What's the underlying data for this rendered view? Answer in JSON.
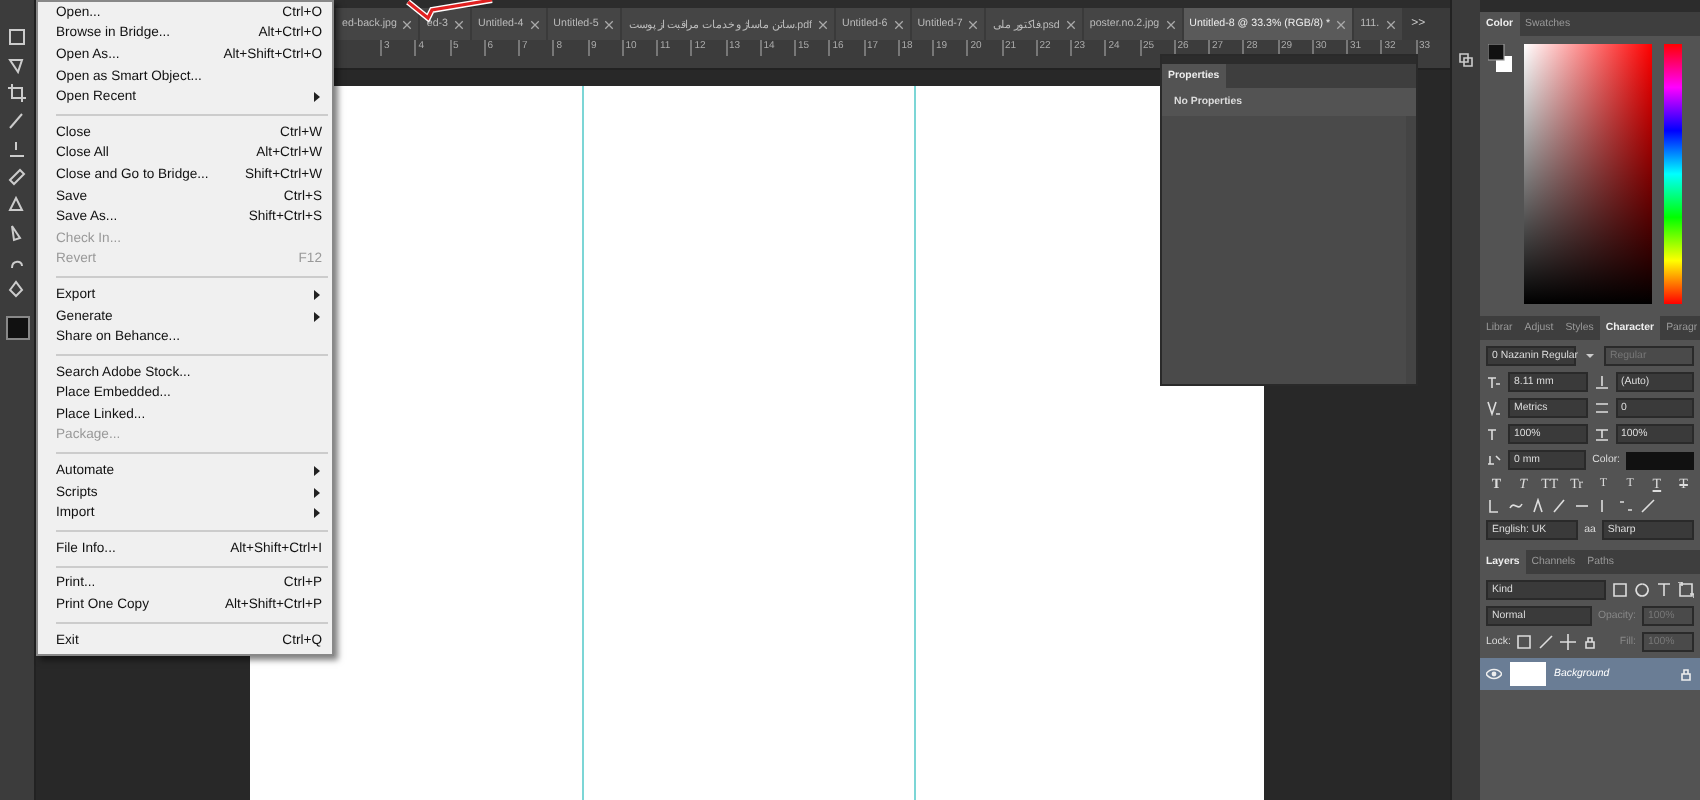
{
  "file_menu": {
    "items": [
      {
        "kind": "item",
        "label": "Open...",
        "shortcut": "Ctrl+O",
        "submenu": false,
        "disabled": false
      },
      {
        "kind": "item",
        "label": "Browse in Bridge...",
        "shortcut": "Alt+Ctrl+O",
        "submenu": false,
        "disabled": false
      },
      {
        "kind": "item",
        "label": "Open As...",
        "shortcut": "Alt+Shift+Ctrl+O",
        "submenu": false,
        "disabled": false
      },
      {
        "kind": "item",
        "label": "Open as Smart Object...",
        "submenu": false,
        "disabled": false
      },
      {
        "kind": "item",
        "label": "Open Recent",
        "submenu": true,
        "disabled": false
      },
      {
        "kind": "separator"
      },
      {
        "kind": "item",
        "label": "Close",
        "shortcut": "Ctrl+W",
        "submenu": false,
        "disabled": false
      },
      {
        "kind": "item",
        "label": "Close All",
        "shortcut": "Alt+Ctrl+W",
        "submenu": false,
        "disabled": false
      },
      {
        "kind": "item",
        "label": "Close and Go to Bridge...",
        "shortcut": "Shift+Ctrl+W",
        "submenu": false,
        "disabled": false
      },
      {
        "kind": "item",
        "label": "Save",
        "shortcut": "Ctrl+S",
        "submenu": false,
        "disabled": false
      },
      {
        "kind": "item",
        "label": "Save As...",
        "shortcut": "Shift+Ctrl+S",
        "submenu": false,
        "disabled": false
      },
      {
        "kind": "item",
        "label": "Check In...",
        "submenu": false,
        "disabled": true
      },
      {
        "kind": "item",
        "label": "Revert",
        "shortcut": "F12",
        "submenu": false,
        "disabled": true
      },
      {
        "kind": "separator"
      },
      {
        "kind": "item",
        "label": "Export",
        "submenu": true,
        "disabled": false
      },
      {
        "kind": "item",
        "label": "Generate",
        "submenu": true,
        "disabled": false
      },
      {
        "kind": "item",
        "label": "Share on Behance...",
        "submenu": false,
        "disabled": false
      },
      {
        "kind": "separator"
      },
      {
        "kind": "item",
        "label": "Search Adobe Stock...",
        "submenu": false,
        "disabled": false
      },
      {
        "kind": "item",
        "label": "Place Embedded...",
        "submenu": false,
        "disabled": false
      },
      {
        "kind": "item",
        "label": "Place Linked...",
        "submenu": false,
        "disabled": false
      },
      {
        "kind": "item",
        "label": "Package...",
        "submenu": false,
        "disabled": true
      },
      {
        "kind": "separator"
      },
      {
        "kind": "item",
        "label": "Automate",
        "submenu": true,
        "disabled": false
      },
      {
        "kind": "item",
        "label": "Scripts",
        "submenu": true,
        "disabled": false
      },
      {
        "kind": "item",
        "label": "Import",
        "submenu": true,
        "disabled": false
      },
      {
        "kind": "separator"
      },
      {
        "kind": "item",
        "label": "File Info...",
        "shortcut": "Alt+Shift+Ctrl+I",
        "submenu": false,
        "disabled": false
      },
      {
        "kind": "separator"
      },
      {
        "kind": "item",
        "label": "Print...",
        "shortcut": "Ctrl+P",
        "submenu": false,
        "disabled": false
      },
      {
        "kind": "item",
        "label": "Print One Copy",
        "shortcut": "Alt+Shift+Ctrl+P",
        "submenu": false,
        "disabled": false
      },
      {
        "kind": "separator"
      },
      {
        "kind": "item",
        "label": "Exit",
        "shortcut": "Ctrl+Q",
        "submenu": false,
        "disabled": false
      }
    ]
  },
  "document_tabs": [
    {
      "label": "ed-back.jpg",
      "selected": false
    },
    {
      "label": "ed-3",
      "selected": false
    },
    {
      "label": "Untitled-4",
      "selected": false
    },
    {
      "label": "Untitled-5",
      "selected": false
    },
    {
      "label": "ساتن ماساژ و خدمات مراقبت از پوست.pdf",
      "selected": false
    },
    {
      "label": "Untitled-6",
      "selected": false
    },
    {
      "label": "Untitled-7",
      "selected": false
    },
    {
      "label": "فاکتور ملی.psd",
      "selected": false
    },
    {
      "label": "poster.no.2.jpg",
      "selected": false
    },
    {
      "label": "Untitled-8 @ 33.3% (RGB/8) *",
      "selected": true
    },
    {
      "label": "111.",
      "selected": false
    }
  ],
  "tabs_overflow": ">>",
  "ruler": [
    "3",
    "4",
    "5",
    "6",
    "7",
    "8",
    "9",
    "10",
    "11",
    "12",
    "13",
    "14",
    "15",
    "16",
    "17",
    "18",
    "19",
    "20",
    "21",
    "22",
    "23",
    "24",
    "25",
    "26",
    "27",
    "28",
    "29",
    "30",
    "31",
    "32",
    "33"
  ],
  "properties_panel": {
    "tab": "Properties",
    "message": "No Properties"
  },
  "color_panel": {
    "tabs": [
      {
        "label": "Color",
        "selected": true
      },
      {
        "label": "Swatches",
        "selected": false
      }
    ]
  },
  "character_panel": {
    "tabs": [
      {
        "label": "Librar",
        "selected": false
      },
      {
        "label": "Adjust",
        "selected": false
      },
      {
        "label": "Styles",
        "selected": false
      },
      {
        "label": "Character",
        "selected": true
      },
      {
        "label": "Paragr",
        "selected": false
      }
    ],
    "font": "0 Nazanin Regular",
    "style": "Regular",
    "size": "8.11 mm",
    "leading": "(Auto)",
    "kerning": "Metrics",
    "tracking": "0",
    "vertical_scale": "100%",
    "horizontal_scale": "100%",
    "baseline_shift": "0 mm",
    "color_label": "Color:",
    "style_buttons": [
      {
        "kind": "bold",
        "label": "T"
      },
      {
        "kind": "italic",
        "label": "T"
      },
      {
        "kind": "caps",
        "label": "TT"
      },
      {
        "kind": "smallcaps",
        "label": "Tr"
      },
      {
        "kind": "super",
        "label": "T"
      },
      {
        "kind": "sub",
        "label": "T"
      },
      {
        "kind": "underline",
        "label": "T"
      },
      {
        "kind": "strike",
        "label": "T"
      }
    ],
    "language": "English: UK",
    "antialias_label": "aa",
    "antialias": "Sharp"
  },
  "layers_panel": {
    "tabs": [
      {
        "label": "Layers",
        "selected": true
      },
      {
        "label": "Channels",
        "selected": false
      },
      {
        "label": "Paths",
        "selected": false
      }
    ],
    "filter": "Kind",
    "blend_mode": "Normal",
    "opacity_label": "Opacity:",
    "opacity": "100%",
    "lock_label": "Lock:",
    "fill_label": "Fill:",
    "fill": "100%",
    "layers": [
      {
        "name": "Background",
        "selected": true,
        "visible": true,
        "locked": true
      }
    ]
  }
}
